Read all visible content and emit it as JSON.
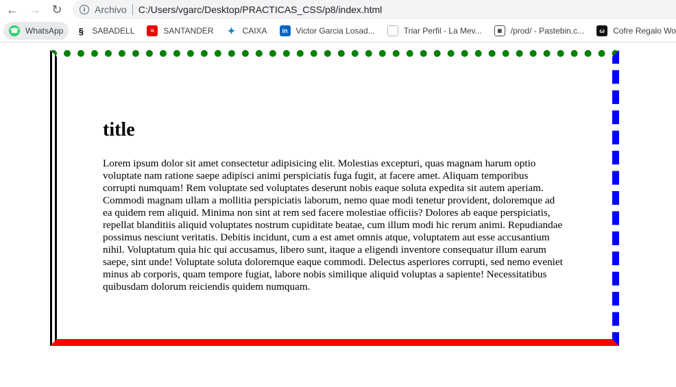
{
  "browser": {
    "security_label": "Archivo",
    "url": "C:/Users/vgarc/Desktop/PRACTICAS_CSS/p8/index.html"
  },
  "bookmarks": [
    {
      "label": "WhatsApp",
      "icon": "whatsapp-icon"
    },
    {
      "label": "SABADELL",
      "icon": "sabadell-icon"
    },
    {
      "label": "SANTANDER",
      "icon": "santander-icon"
    },
    {
      "label": "CAIXA",
      "icon": "caixa-icon"
    },
    {
      "label": "Victor Garcia Losad...",
      "icon": "linkedin-icon"
    },
    {
      "label": "Triar Perfil - La Mev...",
      "icon": "triar-icon"
    },
    {
      "label": "/prod/ - Pastebin.c...",
      "icon": "pastebin-icon"
    },
    {
      "label": "Cofre Regalo Wond...",
      "icon": "cofre-icon"
    }
  ],
  "page": {
    "title": "title",
    "paragraph": "Lorem ipsum dolor sit amet consectetur adipisicing elit. Molestias excepturi, quas magnam harum optio voluptate nam ratione saepe adipisci animi perspiciatis fuga fugit, at facere amet. Aliquam temporibus corrupti numquam! Rem voluptate sed voluptates deserunt nobis eaque soluta expedita sit autem aperiam. Commodi magnam ullam a mollitia perspiciatis laborum, nemo quae modi tenetur provident, doloremque ad ea quidem rem aliquid. Minima non sint at rem sed facere molestiae officiis? Dolores ab eaque perspiciatis, repellat blanditiis aliquid voluptates nostrum cupiditate beatae, cum illum modi hic rerum animi. Repudiandae possimus nesciunt veritatis. Debitis incidunt, cum a est amet omnis atque, voluptatem aut esse accusantium nihil. Voluptatum quia hic qui accusamus, libero sunt, itaque a eligendi inventore consequatur illum earum saepe, sint unde! Voluptate soluta doloremque eaque commodi. Delectus asperiores corrupti, sed nemo eveniet minus ab corporis, quam tempore fugiat, labore nobis similique aliquid voluptas a sapiente! Necessitatibus quibusdam dolorum reiciendis quidem numquam.",
    "border_colors": {
      "left": "#000000",
      "top": "#008000",
      "right": "#0000ff",
      "bottom": "#ff0000"
    }
  }
}
